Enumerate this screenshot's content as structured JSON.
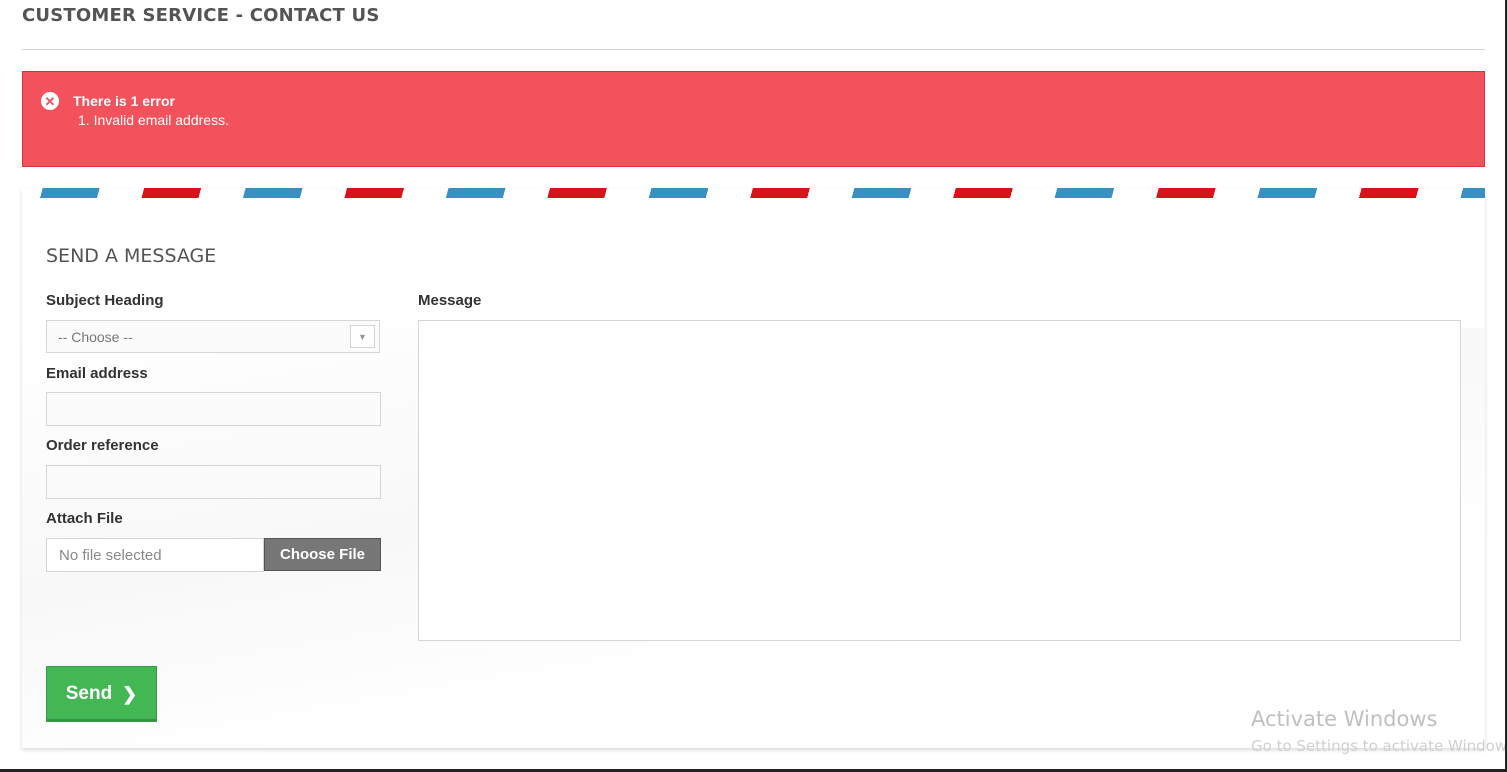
{
  "page": {
    "title": "CUSTOMER SERVICE - CONTACT US"
  },
  "alert": {
    "icon": "close-circle-icon",
    "title": "There is 1 error",
    "errors": [
      "1. Invalid email address."
    ],
    "color": "#f3515c"
  },
  "form": {
    "section_title": "SEND A MESSAGE",
    "subject": {
      "label": "Subject Heading",
      "selected": "-- Choose --"
    },
    "email": {
      "label": "Email address",
      "value": ""
    },
    "order": {
      "label": "Order reference",
      "value": ""
    },
    "attach": {
      "label": "Attach File",
      "file_name": "No file selected",
      "button": "Choose File"
    },
    "message": {
      "label": "Message",
      "value": ""
    },
    "send": {
      "label": "Send",
      "icon": "chevron-right-icon",
      "color": "#43b754"
    }
  },
  "watermark": {
    "line1": "Activate Windows",
    "line2": "Go to Settings to activate Windows."
  }
}
